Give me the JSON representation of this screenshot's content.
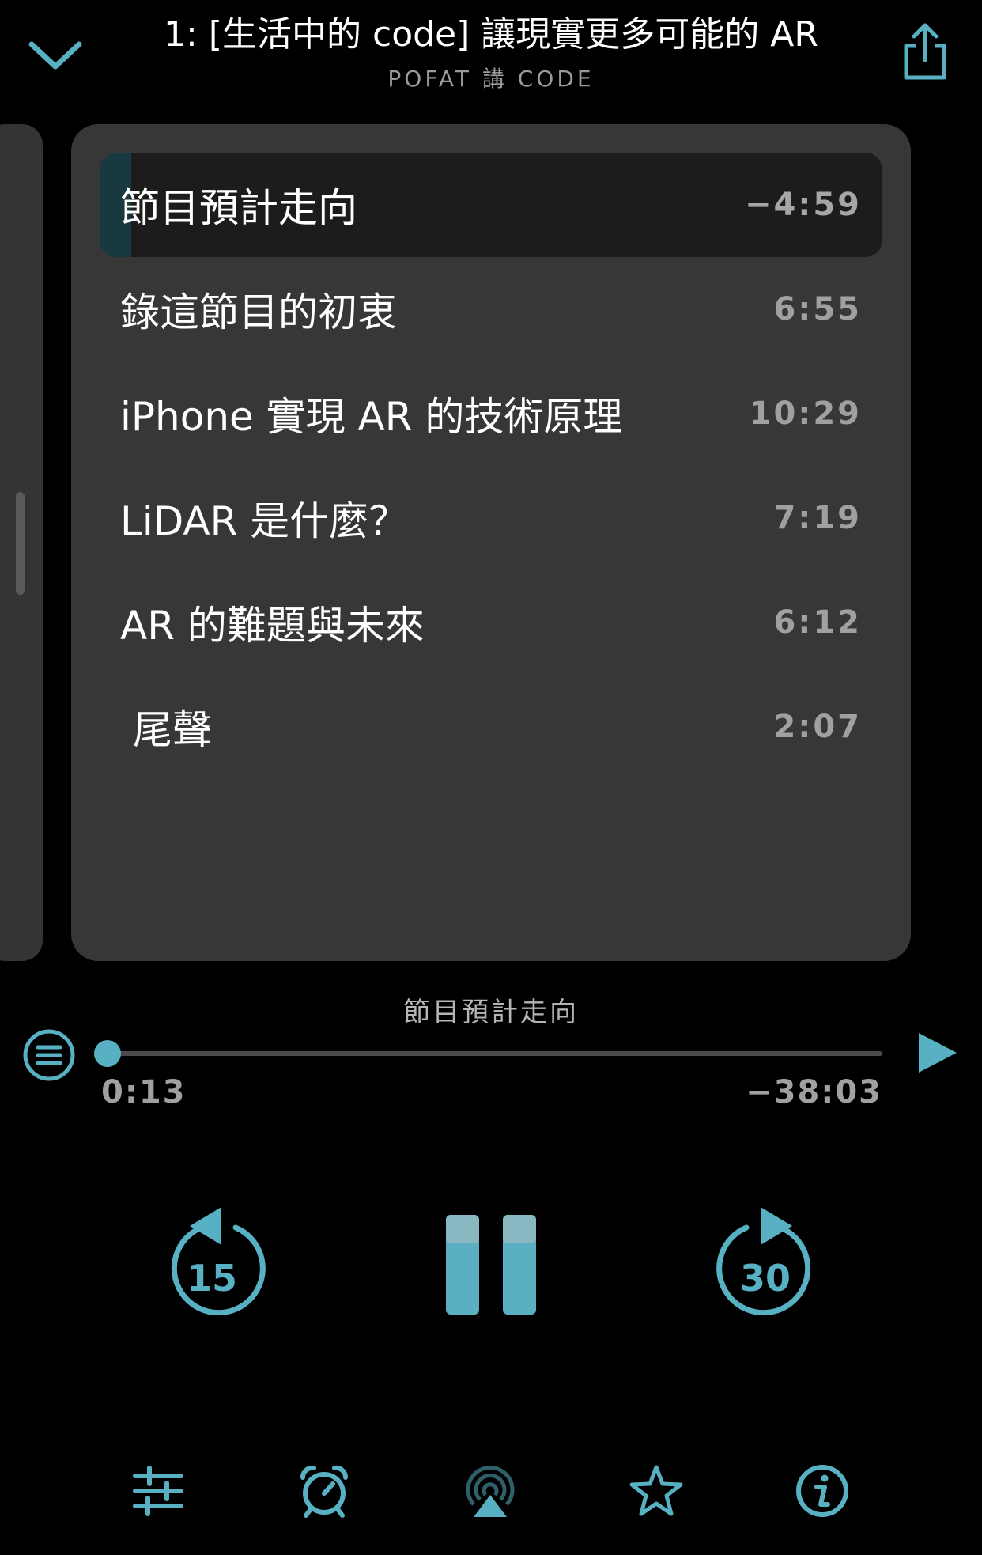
{
  "header": {
    "title": "1: [生活中的 code] 讓現實更多可能的 AR",
    "subtitle": "POFAT 講 CODE"
  },
  "chapters": [
    {
      "title": "節目預計走向",
      "time": "−4:59",
      "active": true,
      "progress": 0.04
    },
    {
      "title": "錄這節目的初衷",
      "time": "6:55"
    },
    {
      "title": "iPhone 實現 AR 的技術原理",
      "time": "10:29"
    },
    {
      "title": "LiDAR 是什麼？",
      "time": "7:19"
    },
    {
      "title": "AR 的難題與未來",
      "time": "6:12"
    },
    {
      "title": " 尾聲",
      "time": "2:07"
    }
  ],
  "player": {
    "current_chapter": "節目預計走向",
    "elapsed": "0:13",
    "remaining": "−38:03",
    "progress": 0.006,
    "skip_back": "15",
    "skip_forward": "30"
  },
  "colors": {
    "accent": "#58b0c3",
    "background": "#000000",
    "card": "#373737"
  },
  "icons": {
    "collapse": "chevron-down-icon",
    "share": "share-icon",
    "chapters": "list-icon",
    "next": "play-icon",
    "bottom": [
      "sliders-icon",
      "alarm-clock-icon",
      "airplay-icon",
      "star-icon",
      "info-icon"
    ]
  }
}
